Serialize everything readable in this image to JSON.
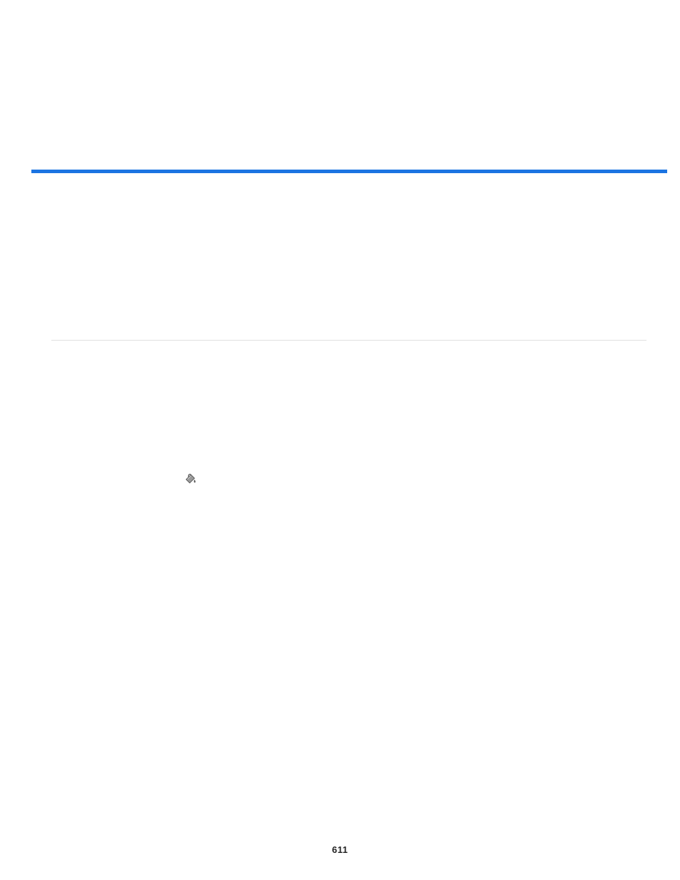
{
  "page": {
    "number": "611"
  },
  "icons": {
    "mid_tool": "paint-bucket-icon"
  },
  "colors": {
    "accent": "#1b74e2",
    "divider": "#e0e0e0",
    "icon": "#6b6b6b"
  }
}
